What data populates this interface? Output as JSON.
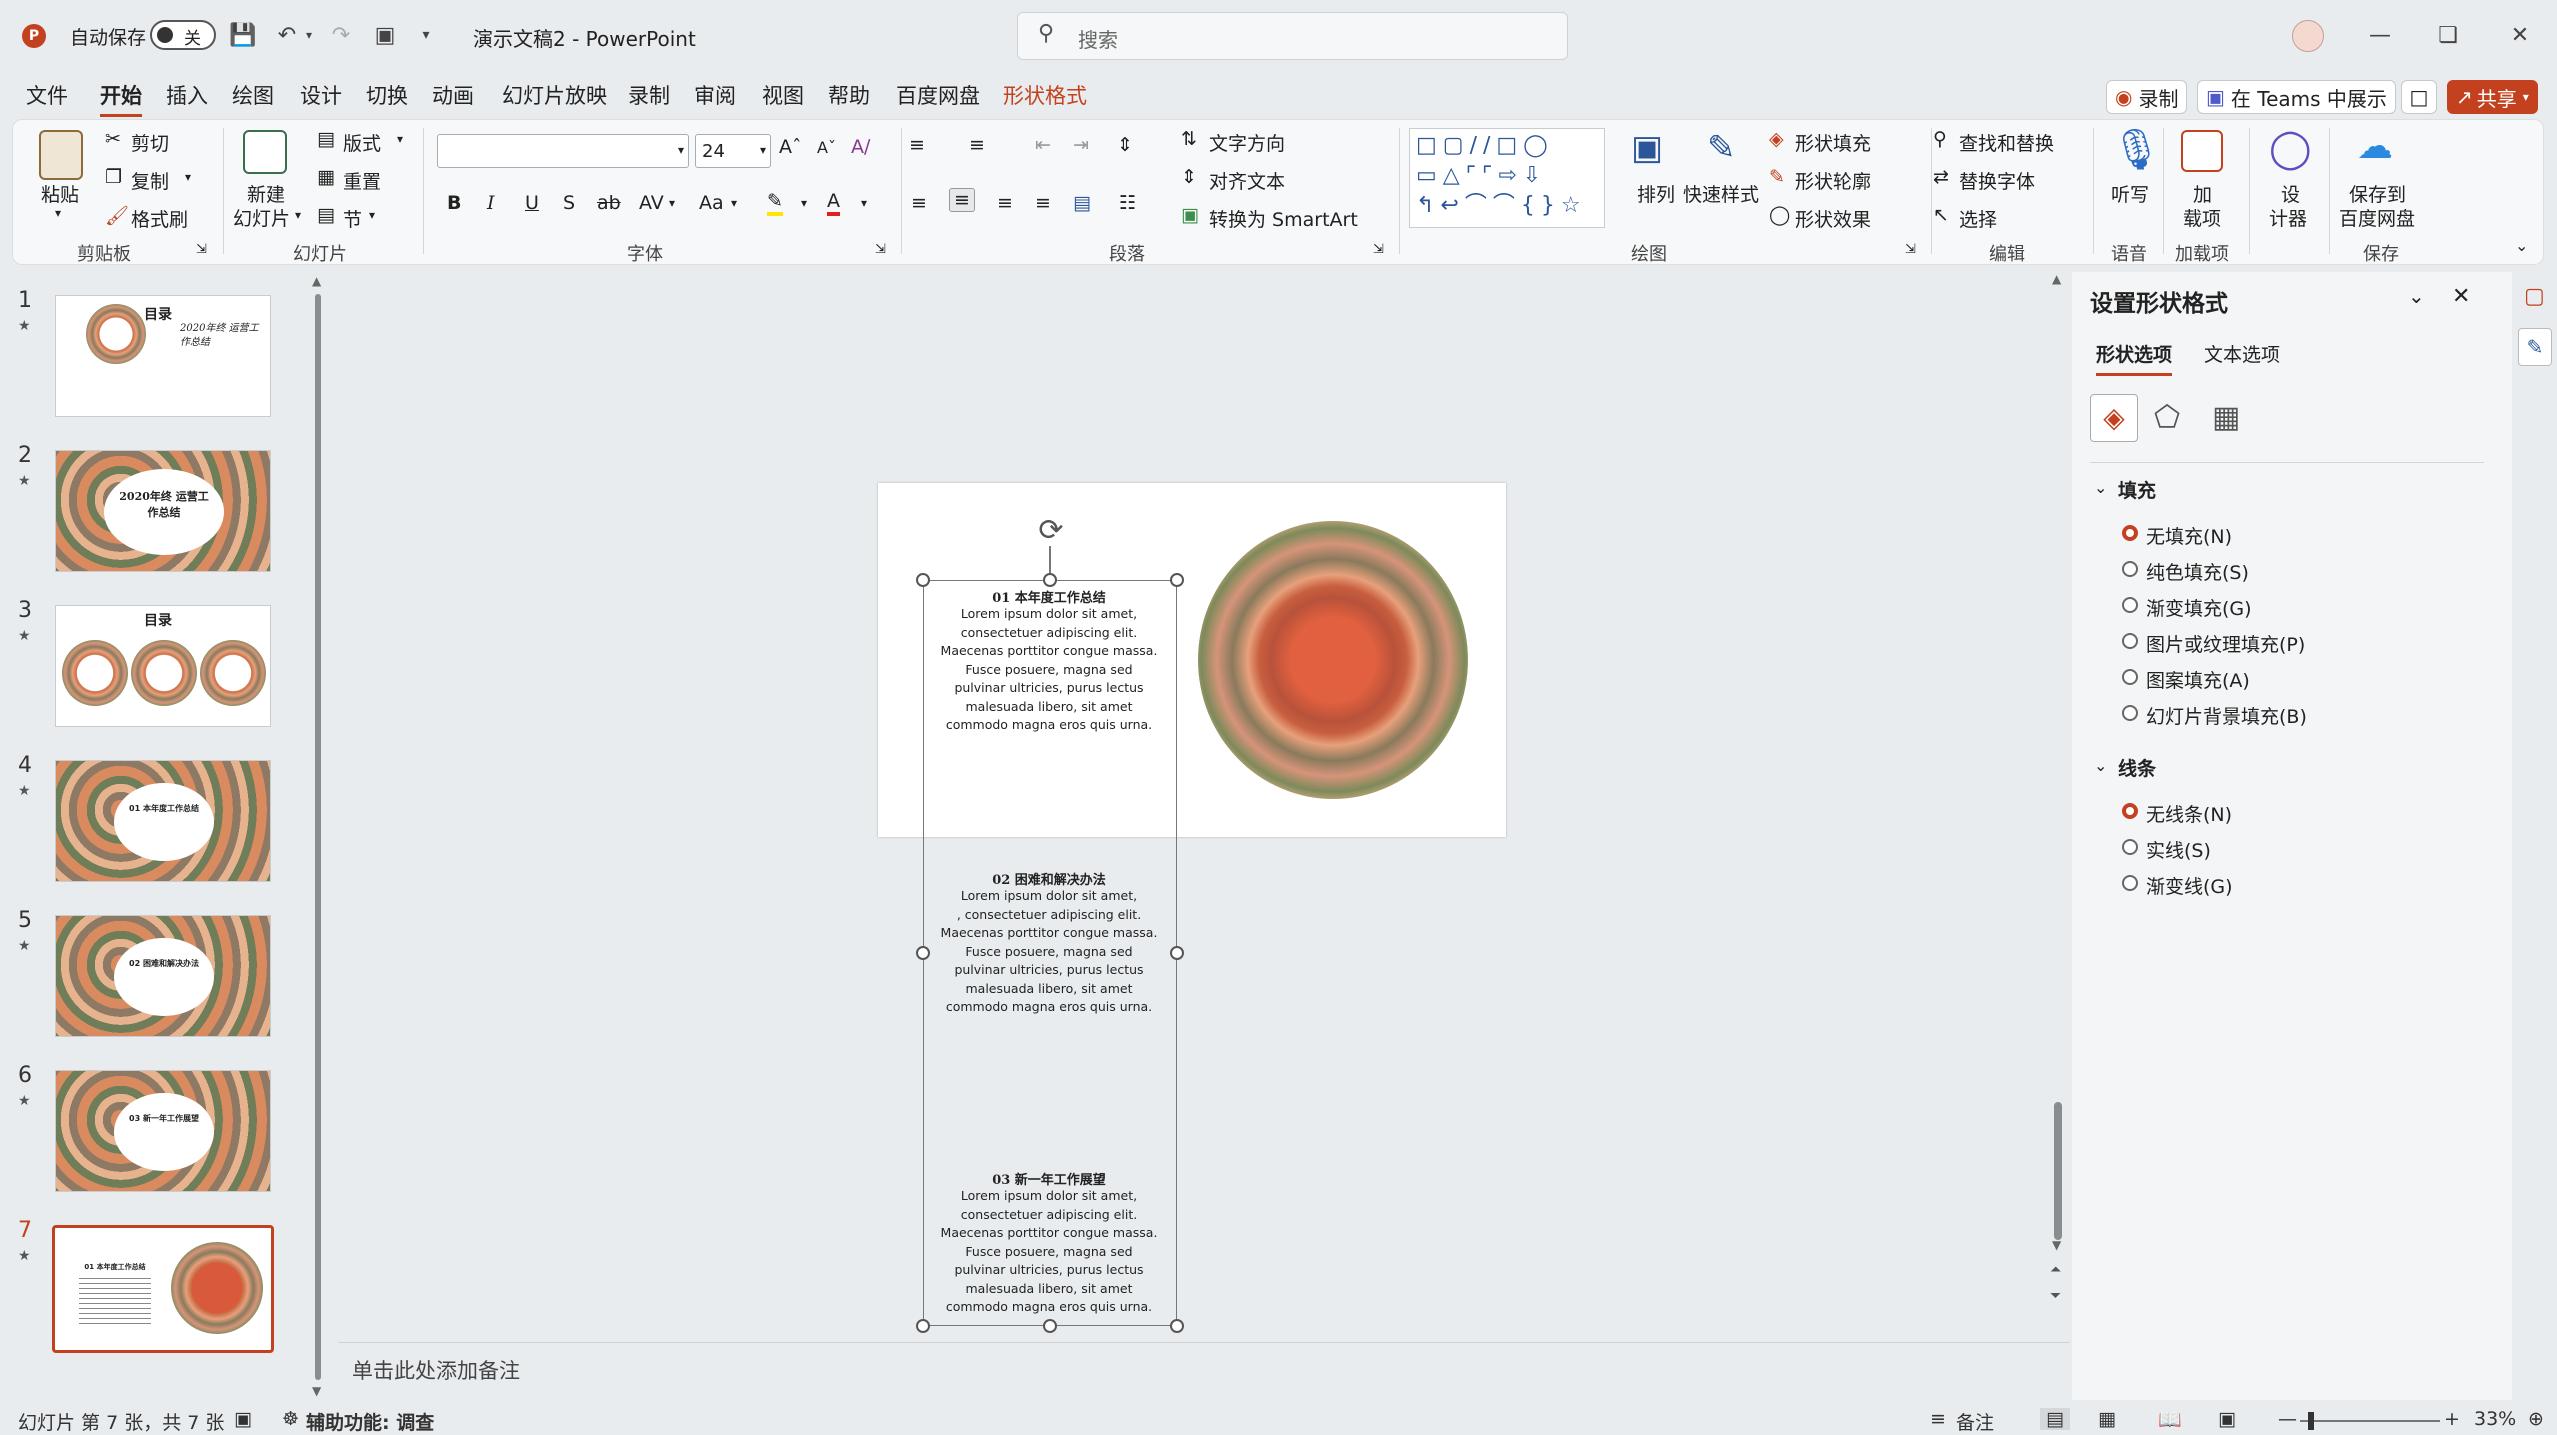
{
  "titlebar": {
    "autosave_label": "自动保存",
    "autosave_state": "关",
    "doc_title": "演示文稿2 - PowerPoint",
    "search_placeholder": "搜索"
  },
  "menu": {
    "file": "文件",
    "home": "开始",
    "insert": "插入",
    "draw": "绘图",
    "design": "设计",
    "transitions": "切换",
    "animations": "动画",
    "slideshow": "幻灯片放映",
    "record": "录制",
    "review": "审阅",
    "view": "视图",
    "help": "帮助",
    "baidu": "百度网盘",
    "shape_format": "形状格式",
    "record_btn": "录制",
    "teams_btn": "在 Teams 中展示",
    "share_btn": "共享"
  },
  "ribbon": {
    "clipboard": {
      "paste": "粘贴",
      "cut": "剪切",
      "copy": "复制",
      "format_painter": "格式刷",
      "label": "剪贴板"
    },
    "slides": {
      "new_slide_line1": "新建",
      "new_slide_line2": "幻灯片",
      "layout": "版式",
      "reset": "重置",
      "section": "节",
      "label": "幻灯片"
    },
    "font": {
      "font_name": "",
      "font_size": "24",
      "bold": "B",
      "italic": "I",
      "underline": "U",
      "shadow": "S",
      "strike": "ab",
      "spacing": "AV",
      "case": "Aa",
      "label": "字体"
    },
    "paragraph": {
      "text_direction": "文字方向",
      "align_text": "对齐文本",
      "smartart": "转换为 SmartArt",
      "label": "段落"
    },
    "drawing": {
      "arrange": "排列",
      "quick_styles": "快速样式",
      "shape_fill": "形状填充",
      "shape_outline": "形状轮廓",
      "shape_effects": "形状效果",
      "label": "绘图"
    },
    "editing": {
      "find_replace": "查找和替换",
      "replace_font": "替换字体",
      "select": "选择",
      "label": "编辑"
    },
    "voice": {
      "dictate": "听写",
      "label": "语音"
    },
    "addins": {
      "addins_line1": "加",
      "addins_line2": "载项",
      "label": "加载项"
    },
    "designer": {
      "line1": "设",
      "line2": "计器"
    },
    "save": {
      "line1": "保存到",
      "line2": "百度网盘",
      "label": "保存"
    }
  },
  "thumbnails": [
    {
      "num": "1",
      "title": "目录",
      "subtitle": "2020年终 运营工作总结"
    },
    {
      "num": "2",
      "title": "2020年终 运营工作总结"
    },
    {
      "num": "3",
      "title": "目录"
    },
    {
      "num": "4",
      "title": "01 本年度工作总结"
    },
    {
      "num": "5",
      "title": "02 困难和解决办法"
    },
    {
      "num": "6",
      "title": "03 新一年工作展望"
    },
    {
      "num": "7",
      "title": "01 本年度工作总结"
    }
  ],
  "slide": {
    "sections": [
      {
        "title": "01 本年度工作总结",
        "lines": [
          "Lorem ipsum dolor sit amet,",
          "consectetuer adipiscing elit.",
          "Maecenas porttitor congue massa.",
          "Fusce posuere, magna sed",
          "pulvinar ultricies, purus lectus",
          "malesuada libero, sit amet",
          "commodo magna eros quis urna."
        ]
      },
      {
        "title": "02 困难和解决办法",
        "lines": [
          "Lorem ipsum dolor sit amet,",
          ", consectetuer adipiscing elit.",
          "Maecenas porttitor congue massa.",
          "Fusce posuere, magna sed",
          "pulvinar ultricies, purus lectus",
          "malesuada libero, sit amet",
          "commodo magna eros quis urna."
        ]
      },
      {
        "title": "03 新一年工作展望",
        "lines": [
          "Lorem ipsum dolor sit amet,",
          "consectetuer adipiscing elit.",
          "Maecenas porttitor congue massa.",
          "Fusce posuere, magna sed",
          "pulvinar ultricies, purus lectus",
          "malesuada libero, sit amet",
          "commodo magna eros quis urna."
        ]
      }
    ]
  },
  "notes_placeholder": "单击此处添加备注",
  "pane": {
    "title": "设置形状格式",
    "tab_shape": "形状选项",
    "tab_text": "文本选项",
    "fill_header": "填充",
    "fill_options": [
      "无填充(N)",
      "纯色填充(S)",
      "渐变填充(G)",
      "图片或纹理填充(P)",
      "图案填充(A)",
      "幻灯片背景填充(B)"
    ],
    "line_header": "线条",
    "line_options": [
      "无线条(N)",
      "实线(S)",
      "渐变线(G)"
    ]
  },
  "status": {
    "slide_info": "幻灯片 第 7 张，共 7 张",
    "accessibility": "辅助功能: 调查",
    "notes": "备注",
    "zoom": "33%"
  },
  "colors": {
    "accent": "#c4411f",
    "brand": "#b7472a"
  }
}
